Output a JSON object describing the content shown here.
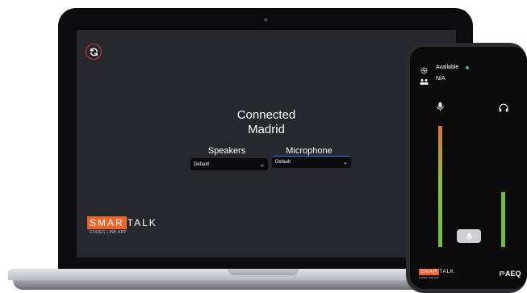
{
  "laptop": {
    "refresh_icon": "refresh-icon",
    "status": {
      "title": "Connected",
      "location": "Madrid"
    },
    "speakers": {
      "label": "Speakers",
      "selected": "Default"
    },
    "microphone": {
      "label": "Microphone",
      "selected": "Default"
    },
    "brand": {
      "smar": "SMAR",
      "talk": "TALK",
      "subtitle": "CODEC LINK APP"
    }
  },
  "phone": {
    "status": {
      "available_label": "Available",
      "users_label": "N/A"
    },
    "meters": {
      "microphone_level": 0.72,
      "headphones_level": 0.33
    },
    "brand": {
      "smar": "SMAR",
      "talk": "TALK",
      "subtitle": "CODEC LINK APP"
    },
    "partner_logo": "AEQ"
  },
  "colors": {
    "accent_orange": "#ec6428",
    "status_green": "#33c46a",
    "refresh_red": "#d6373b",
    "focus_blue": "#3478ff",
    "meter_green": "#6fbf3a"
  }
}
